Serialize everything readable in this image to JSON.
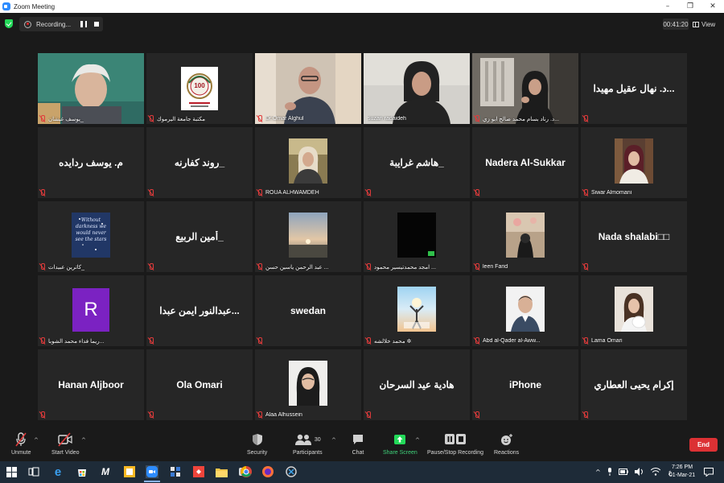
{
  "window": {
    "title": "Zoom Meeting",
    "minimize": "–",
    "maximize": "❐",
    "close": "✕"
  },
  "recording": {
    "status": "Recording..."
  },
  "meeting": {
    "elapsed": "00:41:20",
    "view_label": "View"
  },
  "colors": {
    "active_speaker_border": "#c4e04a",
    "muted_red": "#e03b3b",
    "share_green": "#23d959",
    "end_red": "#dc3134"
  },
  "participants": [
    {
      "name": "يوسف غيشان_",
      "display": "video"
    },
    {
      "name": "مكتبة جامعة اليرموك",
      "display": "photo",
      "photo_text": "100"
    },
    {
      "name": "Dr.Omar Alghul",
      "display": "video"
    },
    {
      "name": "suzan radaideh",
      "display": "video"
    },
    {
      "name": "د. رناد بسام محمد صالح ابو زي...",
      "display": "video",
      "active": true
    },
    {
      "name": "د. نهال عقيل مهيدا...",
      "display": "name"
    },
    {
      "name": "م. يوسف ردايده",
      "display": "name"
    },
    {
      "name": "روند كفارنه_",
      "display": "name"
    },
    {
      "name": "ROUA ALHWAMDEH",
      "display": "photo"
    },
    {
      "name": "هاشم غرايبة_",
      "display": "name"
    },
    {
      "name": "Nadera Al-Sukkar",
      "display": "name"
    },
    {
      "name": "Siwar Almomani",
      "display": "photo"
    },
    {
      "name": "كاترين عبيدات_",
      "display": "photo",
      "photo_text": "Without darkness we would never see the stars"
    },
    {
      "name": "أمين الربيع_",
      "display": "name"
    },
    {
      "name": "عبد الرحمن ياسين حسن ...",
      "display": "photo"
    },
    {
      "name": "امجد محمدتيسير محمود ...",
      "display": "photo"
    },
    {
      "name": "leen Farid",
      "display": "photo"
    },
    {
      "name": "Nada  shalabi□□",
      "display": "name"
    },
    {
      "name": "ريما فداء محمد الشوبا...",
      "display": "avatar",
      "initial": "R"
    },
    {
      "name": "عبدالنور ايمن عبدا...",
      "display": "name"
    },
    {
      "name": "swedan",
      "display": "name"
    },
    {
      "name": "محمد خلالشه ✲",
      "display": "photo"
    },
    {
      "name": "Abd al-Qader al-Aww...",
      "display": "photo"
    },
    {
      "name": "Lama Omari",
      "display": "photo"
    },
    {
      "name": "Hanan Aljboor",
      "display": "name"
    },
    {
      "name": "Ola Omari",
      "display": "name"
    },
    {
      "name": "Alaa Alhussein",
      "display": "photo"
    },
    {
      "name": "هادية عيد السرحان",
      "display": "name"
    },
    {
      "name": "iPhone",
      "display": "name"
    },
    {
      "name": "إكرام يحيى العطاري",
      "display": "name"
    }
  ],
  "toolbar": {
    "unmute": "Unmute",
    "start_video": "Start Video",
    "security": "Security",
    "participants": "Participants",
    "participants_count": "30",
    "chat": "Chat",
    "share_screen": "Share Screen",
    "pause_recording": "Pause/Stop Recording",
    "reactions": "Reactions",
    "end": "End"
  },
  "taskbar": {
    "language": "ع",
    "time": "7:26 PM",
    "date": "01-Mar-21",
    "app_icons": [
      "windows-start-icon",
      "task-view-icon",
      "edge-icon",
      "store-icon",
      "mendeley-icon",
      "file-explorer-tiles-icon",
      "zoom-icon",
      "network-app-icon",
      "anydesk-icon",
      "file-explorer-icon",
      "screen-recorder-icon",
      "chrome-icon",
      "firefox-icon",
      "snipping-tool-icon"
    ]
  }
}
